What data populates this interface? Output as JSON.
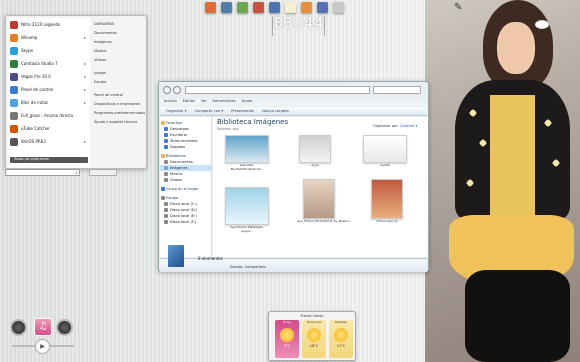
{
  "clock": {
    "time": "03:44"
  },
  "start_menu": {
    "programs": [
      {
        "label": "Nitro 2120 Legends",
        "color": "#c0392b",
        "arrow": ""
      },
      {
        "label": "Winamp",
        "color": "#e67e22",
        "arrow": "▸"
      },
      {
        "label": "Skype",
        "color": "#27a0e0",
        "arrow": ""
      },
      {
        "label": "Camtasia Studio 7",
        "color": "#2e7d32",
        "arrow": "▸"
      },
      {
        "label": "Vegas Pro 10.0",
        "color": "#4a4a8a",
        "arrow": "▸"
      },
      {
        "label": "Panel de control",
        "color": "#3a7bd5",
        "arrow": "▸"
      },
      {
        "label": "Bloc de notas",
        "color": "#4aa3df",
        "arrow": "▸"
      },
      {
        "label": "Full_glass - Acceso directo",
        "color": "#777777",
        "arrow": ""
      },
      {
        "label": "uTube Catcher",
        "color": "#d35400",
        "arrow": ""
      },
      {
        "label": "WinOS PR63",
        "color": "#555555",
        "arrow": "▸"
      }
    ],
    "all_programs": "Todos los programas",
    "places": [
      {
        "label": "DARKSMDE",
        "gap": false
      },
      {
        "label": "Documentos",
        "gap": false
      },
      {
        "label": "Imágenes",
        "gap": false
      },
      {
        "label": "Música",
        "gap": false
      },
      {
        "label": "Videos",
        "gap": false
      },
      {
        "label": "Juegos",
        "gap": true
      },
      {
        "label": "Equipo",
        "gap": false
      },
      {
        "label": "Panel de control",
        "gap": true
      },
      {
        "label": "Dispositivos e impresoras",
        "gap": false
      },
      {
        "label": "Programas predeterminados",
        "gap": false
      },
      {
        "label": "Ayuda y soporte técnico",
        "gap": false
      }
    ]
  },
  "explorer": {
    "menu": [
      "Archivo",
      "Edición",
      "Ver",
      "Herramientas",
      "Ayuda"
    ],
    "commands": [
      "Organizar ▾",
      "Compartir con ▾",
      "Presentación",
      "Nueva carpeta"
    ],
    "sidebar": [
      {
        "label": "Favoritos",
        "header": true,
        "color": "#e8b64a"
      },
      {
        "label": "Descargas",
        "color": "#3a7bd5"
      },
      {
        "label": "Escritorio",
        "color": "#3a7bd5"
      },
      {
        "label": "Sitios recientes",
        "color": "#3a7bd5"
      },
      {
        "label": "Dropbox",
        "color": "#3a7bd5"
      },
      {
        "label": "Bibliotecas",
        "header": true,
        "color": "#e8b64a"
      },
      {
        "label": "Documentos",
        "color": "#888"
      },
      {
        "label": "Imágenes",
        "color": "#6fa8dc",
        "selected": true
      },
      {
        "label": "Música",
        "color": "#888"
      },
      {
        "label": "Vídeos",
        "color": "#888"
      },
      {
        "label": "Grupo en el hogar",
        "header": true,
        "color": "#3a7bd5"
      },
      {
        "label": "Equipo",
        "header": true,
        "color": "#888"
      },
      {
        "label": "Disco local (C:)",
        "color": "#888"
      },
      {
        "label": "Disco local (D:)",
        "color": "#888"
      },
      {
        "label": "Disco local (E:)",
        "color": "#888"
      },
      {
        "label": "Disco local (F:)",
        "color": "#888"
      }
    ],
    "library_title": "Biblioteca Imágenes",
    "library_subtitle": "Entorno: aya",
    "arrange_label": "Organizar por:",
    "arrange_value": "Carpeta ▾",
    "thumbnails": [
      {
        "caption": "aya-ueto-8bd7e6d9cd4e6cdd...",
        "bg": "linear-gradient(#5fa3c9,#dceaf2)"
      },
      {
        "caption": "Ayya",
        "bg": "linear-gradient(#d0d0d0,#f2f2f2)"
      },
      {
        "caption": "Aya18",
        "bg": "linear-gradient(#ffffff,#e8e8e8)"
      },
      {
        "caption": "Aya-Hirano-Wallpaper-ayaya...",
        "bg": "linear-gradient(#9fd3e8,#e8f6fb)"
      },
      {
        "caption": "Aya_Hirano_Photoshoot_by_Beesco",
        "bg": "linear-gradient(#e7d3c2,#b59a88)"
      },
      {
        "caption": "Hirano Aya ya",
        "bg": "linear-gradient(#c0593e,#e8b080)"
      }
    ],
    "items_count": "8 elementos",
    "status_label": "Estado:",
    "status_value": "Compartido"
  },
  "weather": {
    "title": "Puerto Viento",
    "days": [
      {
        "label": "Today",
        "temp": "4°C"
      },
      {
        "label": "Tomorrow",
        "temp": "18°C"
      },
      {
        "label": "Tuesday",
        "temp": "12°C"
      }
    ]
  },
  "media": {
    "center_icon": "music-icon",
    "play_icon": "play-icon"
  },
  "dock": [
    {
      "name": "folder-dock-icon",
      "color": "#e26b2f"
    },
    {
      "name": "network-dock-icon",
      "color": "#4f7fa8"
    },
    {
      "name": "apps-dock-icon",
      "color": "#6aa84f"
    },
    {
      "name": "paint-dock-icon",
      "color": "#c9513d"
    },
    {
      "name": "help-dock-icon",
      "color": "#4a74b5"
    },
    {
      "name": "photo-dock-icon",
      "color": "#f2f2d0"
    },
    {
      "name": "media-dock-icon",
      "color": "#e69138"
    },
    {
      "name": "tools-dock-icon",
      "color": "#5b6fb5"
    },
    {
      "name": "trash-dock-icon",
      "color": "#c8c8c8"
    }
  ]
}
